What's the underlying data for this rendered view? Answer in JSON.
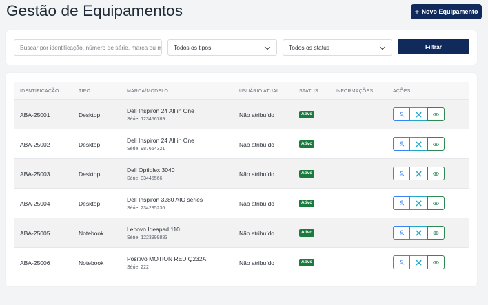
{
  "header": {
    "title": "Gestão de Equipamentos",
    "new_button_icon": "plus-icon",
    "new_button_label": "Novo Equipamento"
  },
  "filters": {
    "search_placeholder": "Buscar por identificação, número de série, marca ou m",
    "type_select": "Todos os tipos",
    "status_select": "Todos os status",
    "filter_button": "Filtrar"
  },
  "table": {
    "headers": [
      "IDENTIFICAÇÃO",
      "TIPO",
      "MARCA/MODELO",
      "USUÁRIO ATUAL",
      "STATUS",
      "INFORMAÇÕES",
      "AÇÕES"
    ],
    "rows": [
      {
        "id": "ABA-25001",
        "type": "Desktop",
        "brand": "Dell Inspiron 24 All in One",
        "serial": "Série: 123456789",
        "user": "Não atribuído",
        "status": "Ativo"
      },
      {
        "id": "ABA-25002",
        "type": "Desktop",
        "brand": "Dell Inspiron 24 All in One",
        "serial": "Série: 987654321",
        "user": "Não atribuído",
        "status": "Ativo"
      },
      {
        "id": "ABA-25003",
        "type": "Desktop",
        "brand": "Dell Optiplex 3040",
        "serial": "Série: 33445566",
        "user": "Não atribuído",
        "status": "Ativo"
      },
      {
        "id": "ABA-25004",
        "type": "Desktop",
        "brand": "Dell Inspiron 3280 AIO séries",
        "serial": "Série: 234235236",
        "user": "Não atribuído",
        "status": "Ativo"
      },
      {
        "id": "ABA-25005",
        "type": "Notebook",
        "brand": "Lenovo Ideapad 110",
        "serial": "Série: 1223999883",
        "user": "Não atribuído",
        "status": "Ativo"
      },
      {
        "id": "ABA-25006",
        "type": "Notebook",
        "brand": "Positivo MOTION RED Q232A",
        "serial": "Série: 222",
        "user": "Não atribuído",
        "status": "Ativo"
      }
    ],
    "actions": [
      "assign-user-icon",
      "maintenance-tools-icon",
      "view-eye-icon"
    ]
  },
  "colors": {
    "primary": "#102a5c",
    "status_active": "#1b7a3e",
    "action_user": "#3b82f6",
    "action_tool": "#22a8c4",
    "action_view": "#2f8a52"
  }
}
